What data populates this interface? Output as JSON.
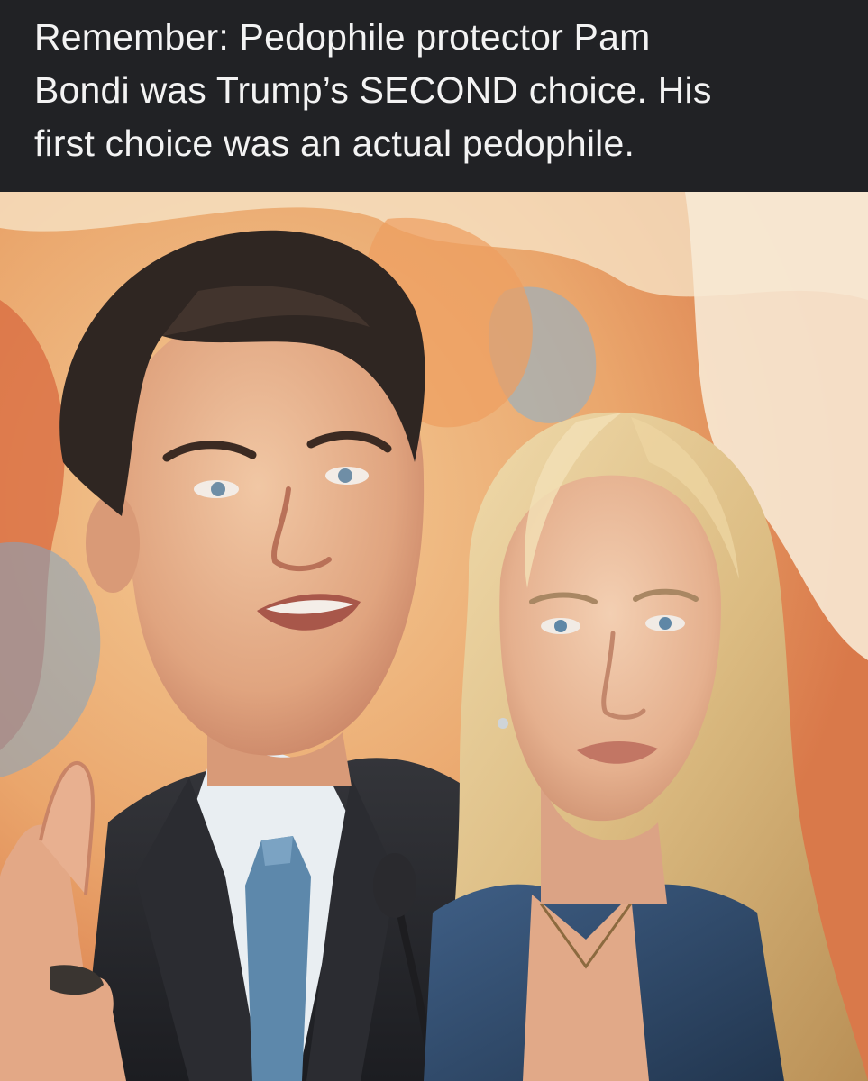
{
  "caption": {
    "text": "Remember: Pedophile protector Pam\nBondi was Trump’s SECOND choice. His\nfirst choice was an actual pedophile."
  },
  "illustration": {
    "kind": "watercolor courtroom-sketch portrait",
    "subjects": [
      "man in dark suit with blue tie gesturing while speaking",
      "blonde woman in blue shirt looking forward"
    ],
    "colors": {
      "caption_background": "#212225",
      "caption_text": "#f3f3f3",
      "wash_orange": "#e58a4e",
      "wash_peach": "#f1c08c",
      "wash_blue": "#7fa4c2",
      "suit": "#26272b",
      "tie": "#5d88ab",
      "woman_shirt": "#2e4a6b",
      "hair_dark": "#2f2622",
      "hair_blonde": "#e2c590",
      "skin": "#e8b896"
    }
  }
}
